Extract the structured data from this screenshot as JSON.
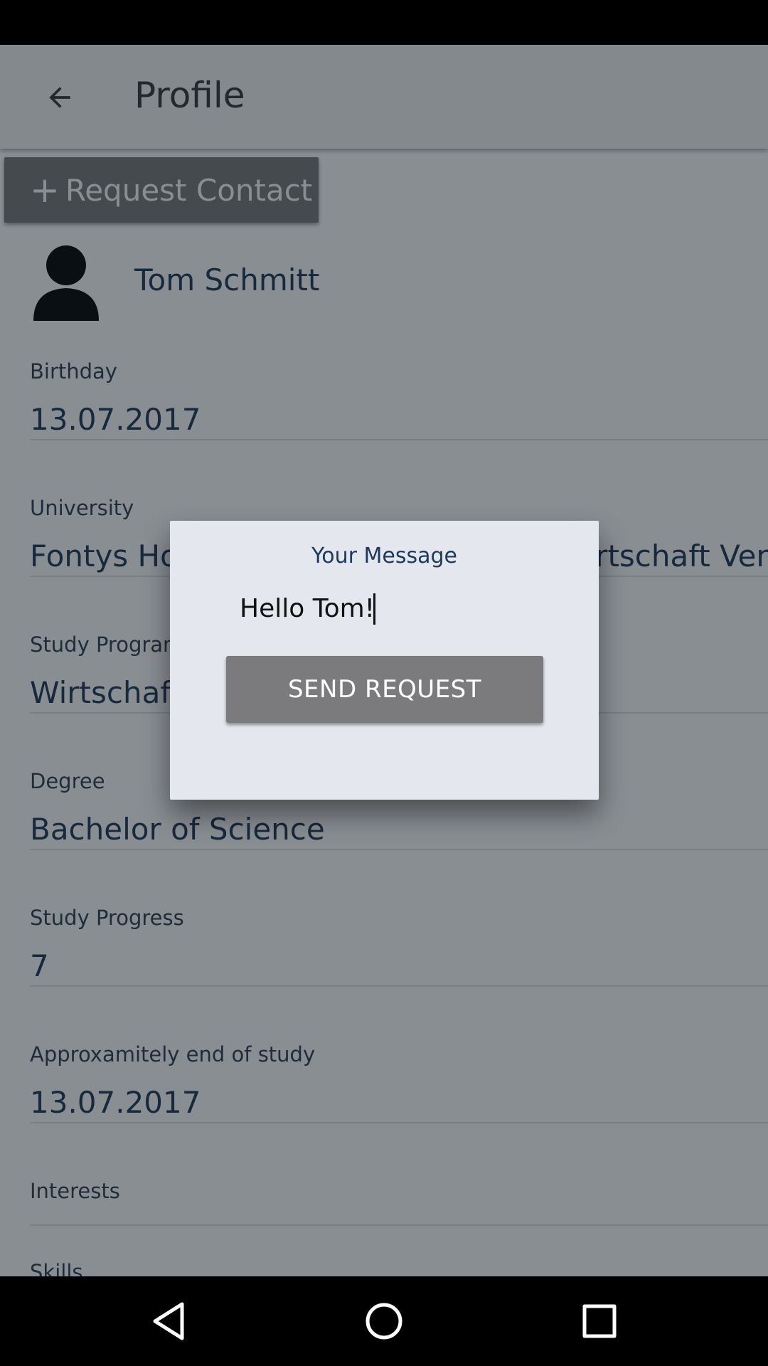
{
  "appbar": {
    "title": "Profile",
    "back_icon": "arrow-back-icon"
  },
  "actions": {
    "request_contact_label": "Request Contact",
    "request_contact_icon": "plus-icon"
  },
  "profile": {
    "name": "Tom Schmitt",
    "avatar_icon": "person-silhouette-icon"
  },
  "fields": [
    {
      "label": "Birthday",
      "value": "13.07.2017"
    },
    {
      "label": "University",
      "value": "Fontys Hochschule für Technik und Wirtschaft Venlo"
    },
    {
      "label": "Study Program",
      "value": "Wirtschaftsinformatik"
    },
    {
      "label": "Degree",
      "value": "Bachelor of Science"
    },
    {
      "label": "Study Progress",
      "value": "7"
    },
    {
      "label": "Approxamitely end of study",
      "value": "13.07.2017"
    },
    {
      "label": "Interests",
      "value": ""
    },
    {
      "label": "Skills",
      "value": ""
    }
  ],
  "dialog": {
    "title": "Your Message",
    "message_value": "Hello Tom! ",
    "send_label": "SEND REQUEST"
  },
  "navigation": {
    "back": "triangle-back-icon",
    "home": "circle-home-icon",
    "recents": "square-recents-icon"
  },
  "colors": {
    "appbar_bg": "#f5f5f5",
    "button_bg": "#777777",
    "text_dark": "#1b3450",
    "dialog_bg": "#e4e8ee"
  }
}
